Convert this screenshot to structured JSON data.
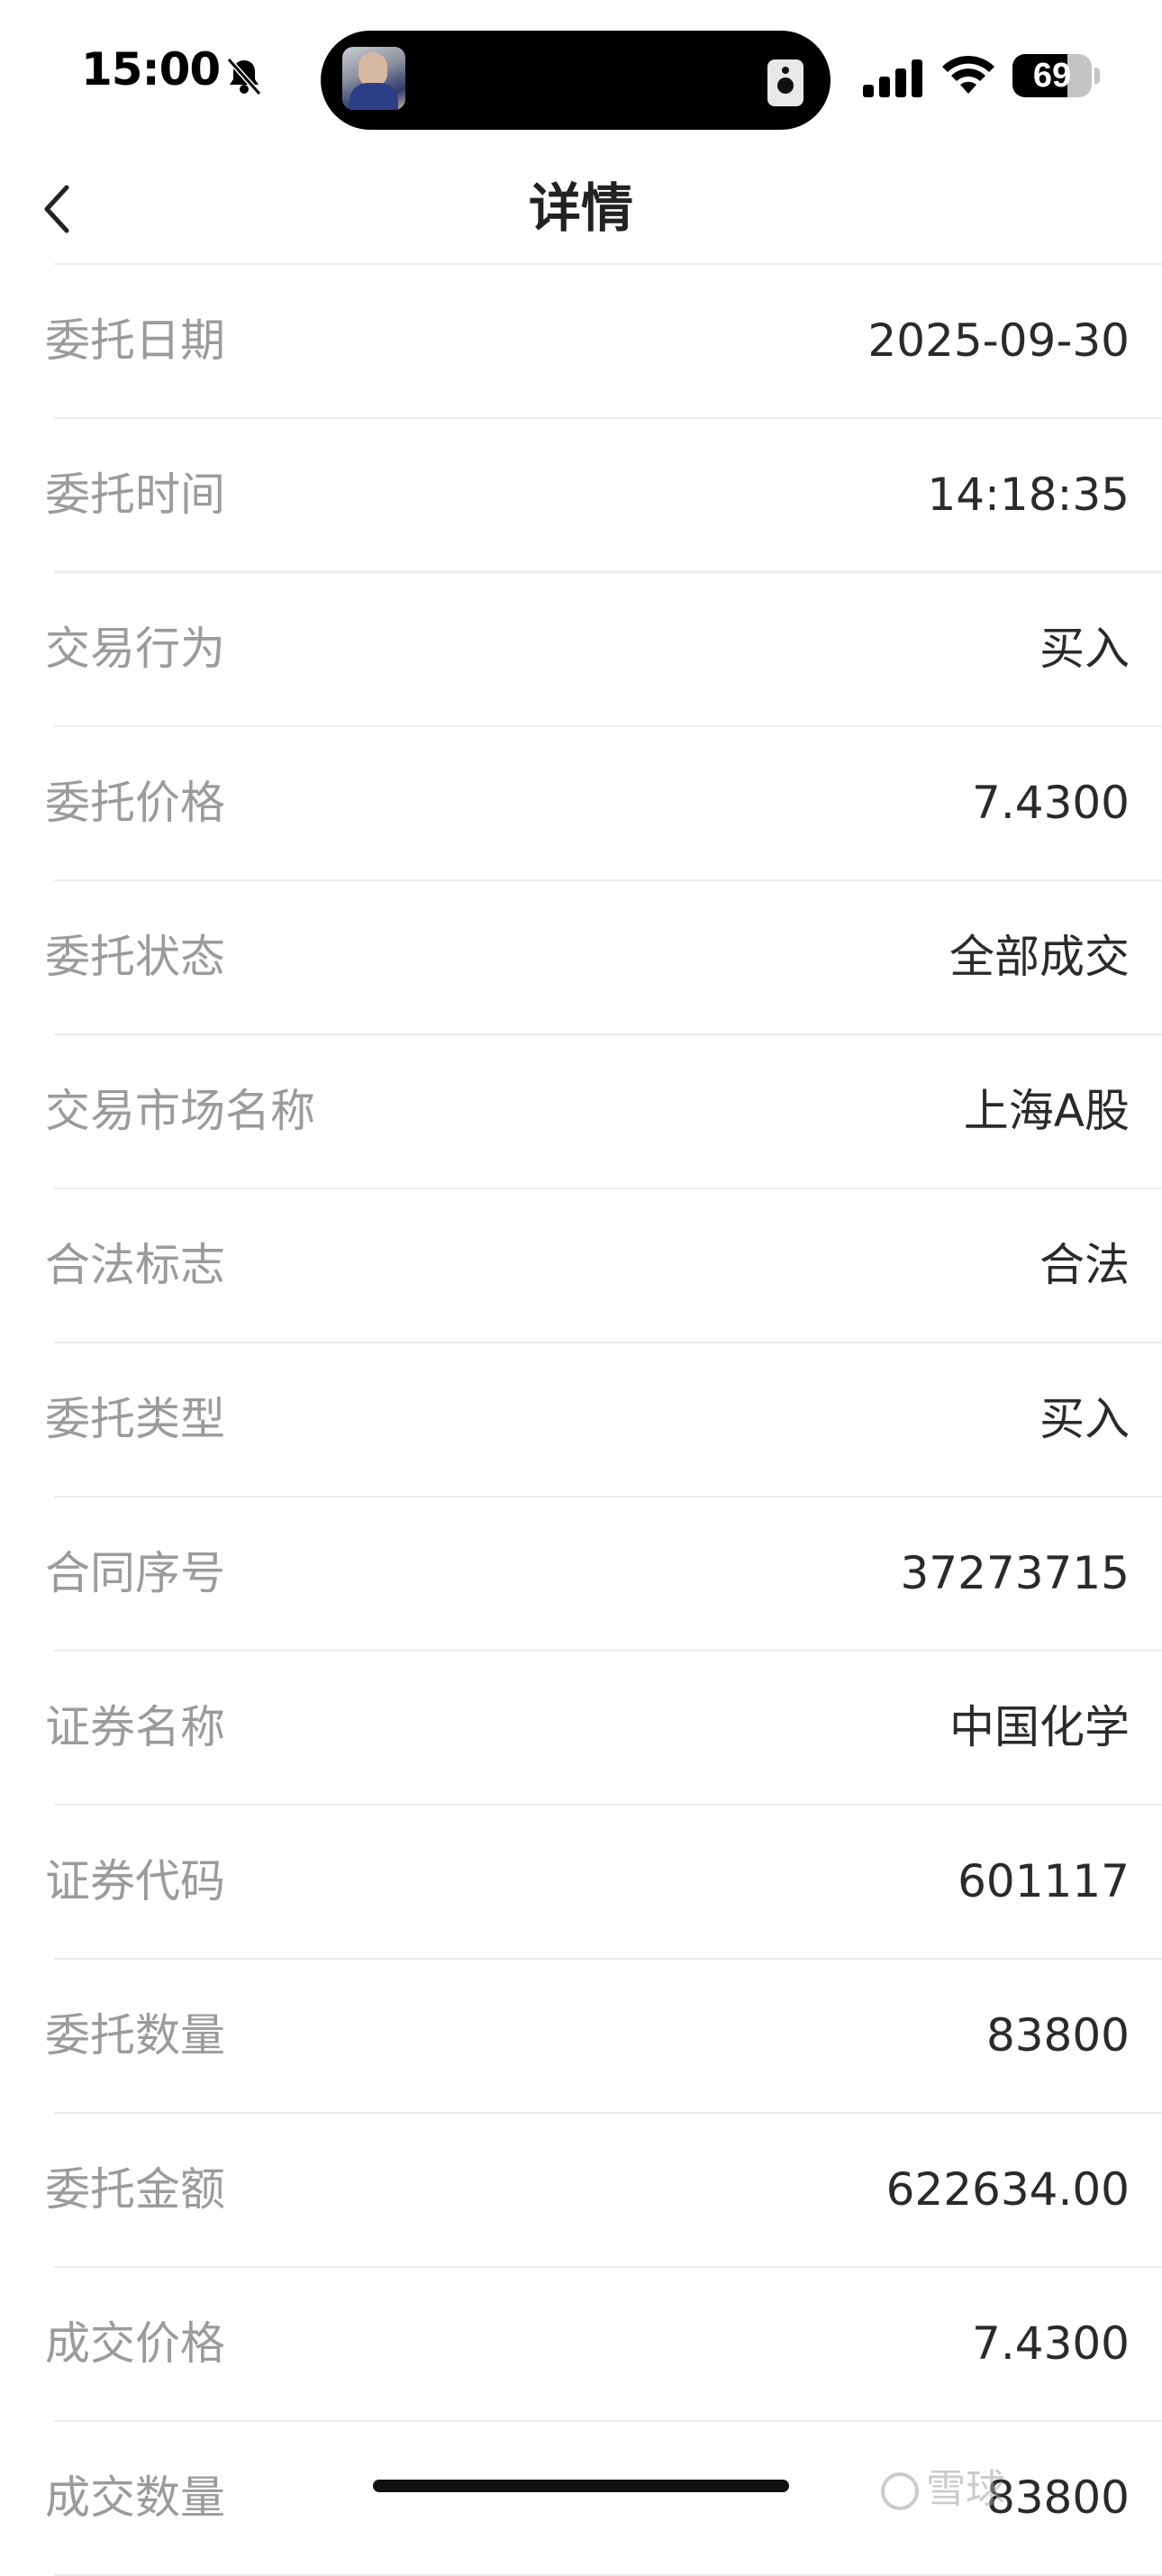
{
  "status_bar": {
    "time": "15:00",
    "battery_level": "69",
    "battery_fraction": 0.69,
    "icons": [
      "bell-slash-icon",
      "signal-icon",
      "wifi-icon",
      "battery-icon",
      "speaker-icon"
    ]
  },
  "nav": {
    "title": "详情",
    "back_icon": "chevron-left-icon"
  },
  "details": [
    {
      "label": "委托日期",
      "value": "2025-09-30"
    },
    {
      "label": "委托时间",
      "value": "14:18:35"
    },
    {
      "label": "交易行为",
      "value": "买入"
    },
    {
      "label": "委托价格",
      "value": "7.4300"
    },
    {
      "label": "委托状态",
      "value": "全部成交"
    },
    {
      "label": "交易市场名称",
      "value": "上海A股"
    },
    {
      "label": "合法标志",
      "value": "合法"
    },
    {
      "label": "委托类型",
      "value": "买入"
    },
    {
      "label": "合同序号",
      "value": "37273715"
    },
    {
      "label": "证券名称",
      "value": "中国化学"
    },
    {
      "label": "证券代码",
      "value": "601117"
    },
    {
      "label": "委托数量",
      "value": "83800"
    },
    {
      "label": "委托金额",
      "value": "622634.00"
    },
    {
      "label": "成交价格",
      "value": "7.4300"
    },
    {
      "label": "成交数量",
      "value": "83800"
    }
  ],
  "watermark": {
    "text": "雪球"
  }
}
